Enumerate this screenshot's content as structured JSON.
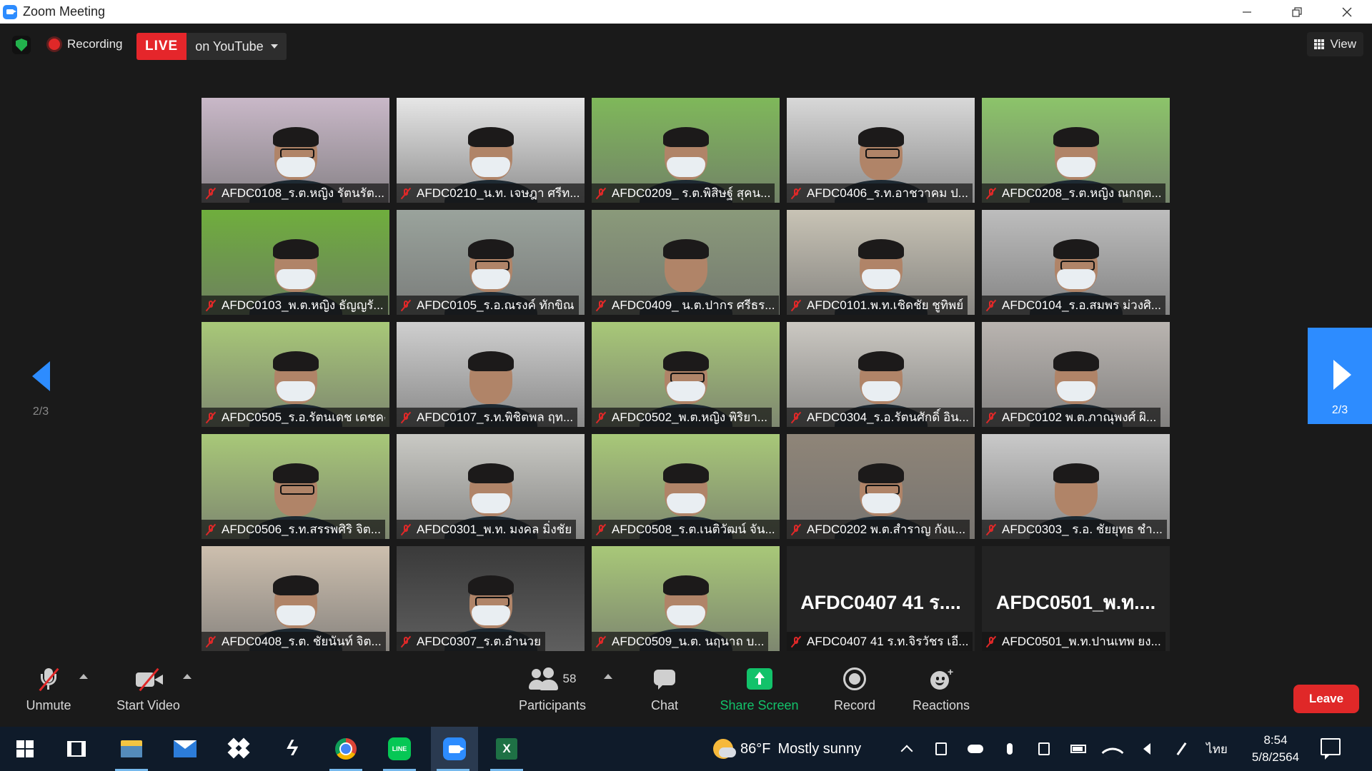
{
  "window": {
    "title": "Zoom Meeting"
  },
  "topbar": {
    "recording_label": "Recording",
    "live_label": "LIVE",
    "live_destination": "on YouTube",
    "view_label": "View"
  },
  "paging": {
    "prev_page": "2/3",
    "next_page": "2/3"
  },
  "colors": {
    "accent": "#2d8cff",
    "live_red": "#e5262b",
    "share_green": "#12c26a",
    "leave_red": "#e02828"
  },
  "participants_tiles": [
    {
      "name": "AFDC0108_ร.ต.หญิง รัตนรัต...",
      "bg": "#c9b8c8",
      "video": true
    },
    {
      "name": "AFDC0210_น.ท. เจษฎา ศรีท...",
      "bg": "#e6e6e6",
      "video": true
    },
    {
      "name": "AFDC0209_ ร.ต.พิสิษฐ์ สุคน...",
      "bg": "#7fb85a",
      "video": true
    },
    {
      "name": "AFDC0406_ร.ท.อาชวาคม ป...",
      "bg": "#d8d8d8",
      "video": true
    },
    {
      "name": "AFDC0208_ร.ต.หญิง ณกฤต...",
      "bg": "#8cc46a",
      "video": true
    },
    {
      "name": "AFDC0103_พ.ต.หญิง ธัญญรั...",
      "bg": "#6fae3d",
      "video": true
    },
    {
      "name": "AFDC0105_ร.อ.ณรงค์ ทักขิณ",
      "bg": "#9aa39c",
      "video": true
    },
    {
      "name": "AFDC0409_ น.ต.ปากร ศรีธร...",
      "bg": "#8a9a7a",
      "video": true
    },
    {
      "name": "AFDC0101.พ.ท.เชิดชัย ชูทิพย์",
      "bg": "#c8c3b5",
      "video": true
    },
    {
      "name": "AFDC0104_ร.อ.สมพร ม่วงศิ...",
      "bg": "#bdbdbd",
      "video": true
    },
    {
      "name": "AFDC0505_ร.อ.รัตนเดช เดชคง",
      "bg": "#a8c878",
      "video": true
    },
    {
      "name": "AFDC0107_ร.ท.พิชิตพล ฤท...",
      "bg": "#cfcfcf",
      "video": true
    },
    {
      "name": "AFDC0502_พ.ต.หญิง พิริยา...",
      "bg": "#a8c878",
      "video": true
    },
    {
      "name": "AFDC0304_ร.อ.รัตนศักดิ์ อิน...",
      "bg": "#cbc8c2",
      "video": true
    },
    {
      "name": "AFDC0102 พ.ต.ภาณุพงศ์ ผิ...",
      "bg": "#b9b4b0",
      "video": true
    },
    {
      "name": "AFDC0506_ร.ท.สรรพศิริ จิต...",
      "bg": "#a8c878",
      "video": true
    },
    {
      "name": "AFDC0301_พ.ท. มงคล มิ่งชัย",
      "bg": "#c9c9c4",
      "video": true
    },
    {
      "name": "AFDC0508_ร.ต.เนติวัฒน์ จัน...",
      "bg": "#a8c878",
      "video": true
    },
    {
      "name": "AFDC0202 พ.ต.สำราญ กังแ...",
      "bg": "#8f8578",
      "video": true
    },
    {
      "name": "AFDC0303_ ร.อ. ชัยยุทธ ชำ...",
      "bg": "#c9c9c9",
      "video": true
    },
    {
      "name": "AFDC0408_ร.ต. ชัยนันท์ จิต...",
      "bg": "#cdbfae",
      "video": true
    },
    {
      "name": "AFDC0307_ร.ต.อำนวย",
      "bg": "#3a3a3a",
      "video": true
    },
    {
      "name": "AFDC0509_น.ต. นฤนาถ บ...",
      "bg": "#a8c878",
      "video": true
    },
    {
      "name": "AFDC0407 41 ร.ท.จิรวัชร เอี...",
      "big_name": "AFDC0407 41 ร....",
      "video": false
    },
    {
      "name": "AFDC0501_พ.ท.ปานเทพ ยง...",
      "big_name": "AFDC0501_พ.ท....",
      "video": false
    }
  ],
  "toolbar": {
    "unmute_label": "Unmute",
    "start_video_label": "Start Video",
    "participants_count": "58",
    "participants_label": "Participants",
    "chat_label": "Chat",
    "share_screen_label": "Share Screen",
    "record_label": "Record",
    "reactions_label": "Reactions",
    "leave_label": "Leave"
  },
  "taskbar": {
    "line_label": "LINE",
    "excel_label": "X",
    "weather_temp": "86°F",
    "weather_text": "Mostly sunny",
    "language": "ไทย",
    "time": "8:54",
    "date": "5/8/2564"
  }
}
